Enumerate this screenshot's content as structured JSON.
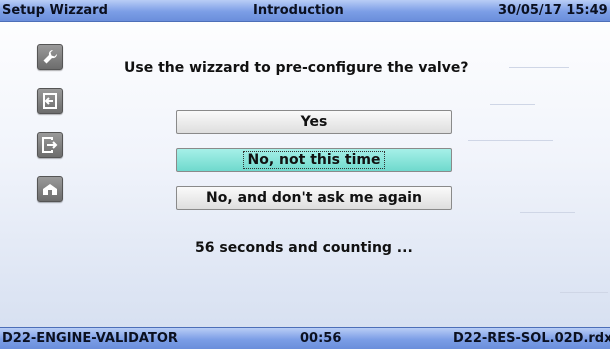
{
  "header": {
    "left": "Setup Wizzard",
    "center": "Introduction",
    "right": "30/05/17 15:49"
  },
  "sidebar": {
    "buttons": [
      {
        "icon": "wrench-icon"
      },
      {
        "icon": "enter-icon"
      },
      {
        "icon": "exit-icon"
      },
      {
        "icon": "home-icon"
      }
    ]
  },
  "dialog": {
    "question": "Use the wizzard to pre-configure the valve?",
    "options": [
      {
        "label": "Yes",
        "selected": false
      },
      {
        "label": "No, not this time",
        "selected": true
      },
      {
        "label": "No, and don't ask me again",
        "selected": false
      }
    ],
    "countdown": "56 seconds and counting ..."
  },
  "footer": {
    "left": "D22-ENGINE-VALIDATOR",
    "center": "00:56",
    "right": "D22-RES-SOL.02D.rdx"
  },
  "colors": {
    "bar": "#7c9ee6",
    "selected_option": "#6fd9cd",
    "side_button": "#7a7a7a"
  }
}
